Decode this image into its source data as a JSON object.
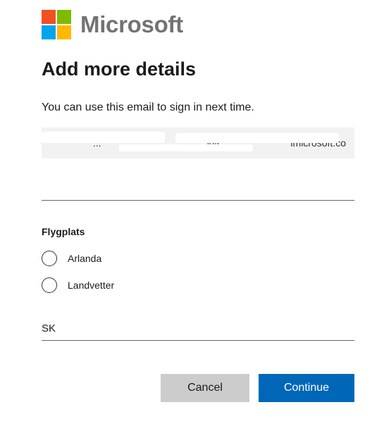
{
  "brand": {
    "name": "Microsoft",
    "colors": {
      "red": "#f25022",
      "green": "#7fba00",
      "blue": "#00a4ef",
      "yellow": "#ffb900",
      "primary_button": "#0067b8"
    }
  },
  "page": {
    "title": "Add more details",
    "subtitle": "You can use this email to sign in next time."
  },
  "email": {
    "value_visible": "...@...microsoft.co"
  },
  "first_field": {
    "value": ""
  },
  "radio_group": {
    "label": "Flygplats",
    "options": [
      {
        "label": "Arlanda",
        "selected": false
      },
      {
        "label": "Landvetter",
        "selected": false
      }
    ]
  },
  "second_field": {
    "value": "SK"
  },
  "buttons": {
    "cancel": "Cancel",
    "continue": "Continue"
  }
}
